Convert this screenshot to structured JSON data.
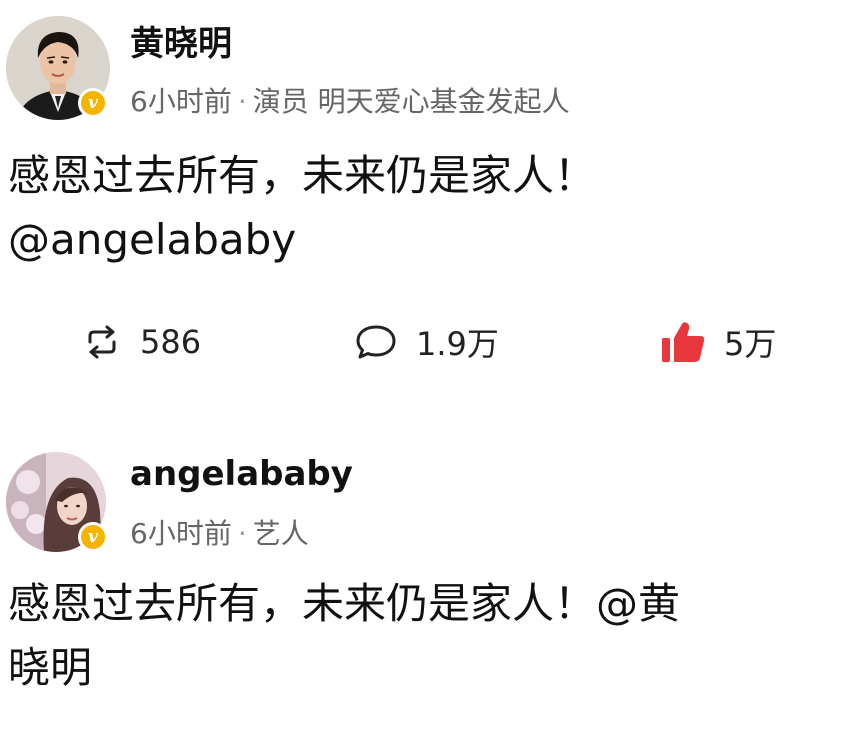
{
  "posts": [
    {
      "username": "黄晓明",
      "time": "6小时前",
      "separator": "·",
      "description": "演员 明天爱心基金发起人",
      "content_line1": "感恩过去所有，未来仍是家人！",
      "content_line2": "@angelababy",
      "badge_icon": "verified-v-icon",
      "badge_letter": "v",
      "badge_color": "#f5b400",
      "actions": {
        "repost_count": "586",
        "comment_count": "1.9万",
        "like_count": "5万"
      },
      "icons": {
        "repost": "repost-icon",
        "comment": "comment-icon",
        "like": "thumbs-up-icon"
      },
      "like_color": "#e8383d"
    },
    {
      "username": "angelababy",
      "time": "6小时前",
      "separator": "·",
      "description": "艺人",
      "content_line1": "感恩过去所有，未来仍是家人！@黄",
      "content_line2": "晓明",
      "badge_icon": "verified-v-icon",
      "badge_letter": "v",
      "badge_color": "#f5b400"
    }
  ]
}
